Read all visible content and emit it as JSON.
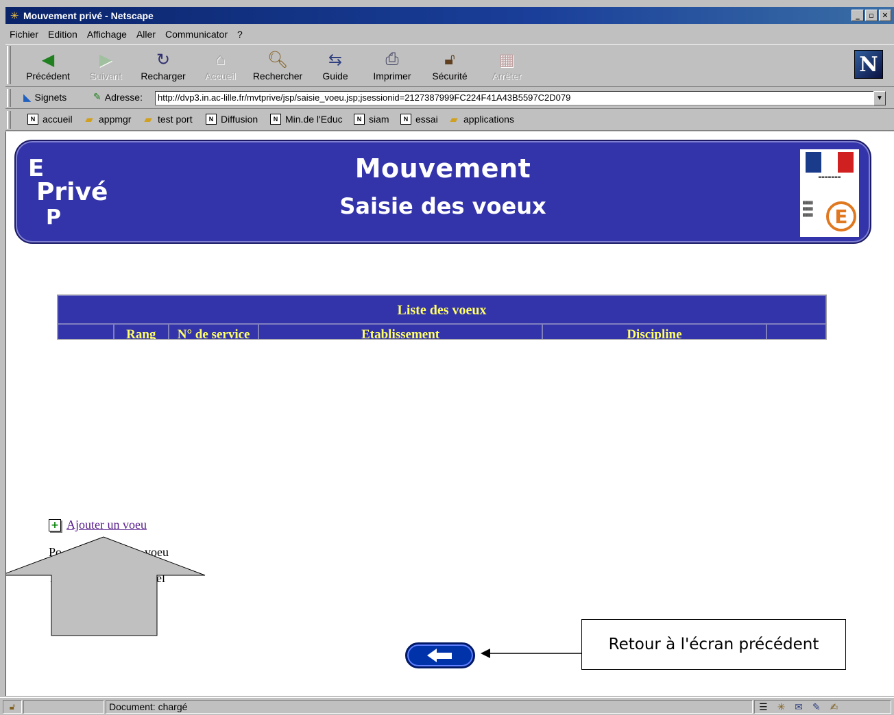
{
  "window": {
    "title": "Mouvement privé - Netscape",
    "buttons": {
      "minimize": "_",
      "maximize": "▫",
      "close": "✕"
    }
  },
  "menubar": {
    "items": [
      "Fichier",
      "Edition",
      "Affichage",
      "Aller",
      "Communicator",
      "?"
    ]
  },
  "toolbar": {
    "buttons": [
      {
        "label": "Précédent",
        "icon": "back-arrow-icon",
        "enabled": true
      },
      {
        "label": "Suivant",
        "icon": "forward-arrow-icon",
        "enabled": false
      },
      {
        "label": "Recharger",
        "icon": "reload-icon",
        "enabled": true
      },
      {
        "label": "Accueil",
        "icon": "home-icon",
        "enabled": false
      },
      {
        "label": "Rechercher",
        "icon": "search-icon",
        "enabled": true
      },
      {
        "label": "Guide",
        "icon": "guide-icon",
        "enabled": true
      },
      {
        "label": "Imprimer",
        "icon": "printer-icon",
        "enabled": true
      },
      {
        "label": "Sécurité",
        "icon": "lock-icon",
        "enabled": true
      },
      {
        "label": "Arrêter",
        "icon": "stop-icon",
        "enabled": false
      }
    ],
    "logo": "N"
  },
  "location": {
    "bookmarks_label": "Signets",
    "address_label": "Adresse:",
    "url": "http://dvp3.in.ac-lille.fr/mvtprive/jsp/saisie_voeu.jsp;jsessionid=2127387999FC224F41A43B5597C2D079"
  },
  "bookmarks": [
    {
      "label": "accueil",
      "type": "page"
    },
    {
      "label": "appmgr",
      "type": "folder"
    },
    {
      "label": "test port",
      "type": "folder"
    },
    {
      "label": "Diffusion",
      "type": "page"
    },
    {
      "label": "Min.de l'Educ",
      "type": "page"
    },
    {
      "label": "siam",
      "type": "page"
    },
    {
      "label": "essai",
      "type": "page"
    },
    {
      "label": "applications",
      "type": "folder"
    }
  ],
  "banner": {
    "logo_letters": [
      "E",
      "Privé",
      "P"
    ],
    "title": "Mouvement",
    "subtitle": "Saisie des voeux"
  },
  "table": {
    "caption": "Liste des voeux",
    "columns": [
      "",
      "Rang",
      "N° de service",
      "Etablissement",
      "Discipline",
      ""
    ]
  },
  "links": {
    "add_wish": "Ajouter un voeu",
    "partial_line1_start": "Po",
    "partial_line1_end": "voeu",
    "partial_line2_start": "I",
    "partial_line2_end": "bel"
  },
  "callout": "Retour à l'écran précédent",
  "status": {
    "text": "Document: chargé"
  },
  "colors": {
    "banner_blue": "#3333aa",
    "caption_text": "#ffff66",
    "titlebar": "#0a246a"
  }
}
